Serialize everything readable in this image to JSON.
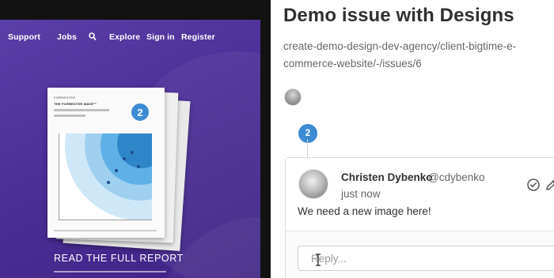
{
  "design_preview": {
    "site_nav": {
      "support": "Support",
      "jobs": "Jobs",
      "search_icon": "search-icon",
      "explore": "Explore",
      "sign_in": "Sign in",
      "register": "Register"
    },
    "report_cover": {
      "brand": "FORRESTER",
      "title": "THE FORRESTER WAVE™"
    },
    "pin_number": "2",
    "cta": "READ THE FULL REPORT",
    "colors": {
      "background": "#4c2f97",
      "pin": "#3d8bd4"
    }
  },
  "issue": {
    "title": "Demo issue with Designs",
    "path": "create-demo-design-dev-agency/client-bigtime-e-commerce-website/-/issues/6"
  },
  "timeline": {
    "badge": "2"
  },
  "comment": {
    "author": "Christen Dybenko",
    "handle": "@cdybenko",
    "time": "just now",
    "body": "We need a new image here!",
    "resolve_icon": "check-circle-icon",
    "edit_icon": "pencil-icon"
  },
  "reply": {
    "placeholder": "Reply..."
  }
}
